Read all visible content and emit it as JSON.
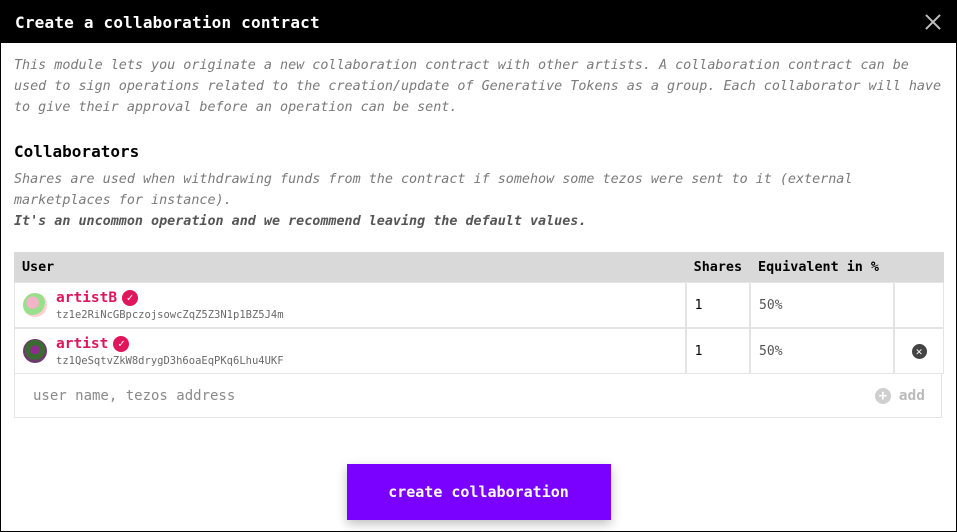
{
  "modal": {
    "title": "Create a collaboration contract",
    "intro": "This module lets you originate a new collaboration contract with other artists. A collaboration contract can be used to sign operations related to the creation/update of Generative Tokens as a group. Each collaborator will have to give their approval before an operation can be sent."
  },
  "collaborators": {
    "heading": "Collaborators",
    "description": "Shares are used when withdrawing funds from the contract if somehow some tezos were sent to it (external marketplaces for instance).",
    "note": "It's an uncommon operation and we recommend leaving the default values.",
    "table": {
      "headers": [
        "User",
        "Shares",
        "Equivalent in %"
      ],
      "rows": [
        {
          "name": "artistB",
          "address": "tz1e2RiNcGBpczojsowcZqZ5Z3N1p1BZ5J4m",
          "shares": "1",
          "percent": "50%"
        },
        {
          "name": "artist",
          "address": "tz1QeSqtvZkW8drygD3h6oaEqPKq6Lhu4UKF",
          "shares": "1",
          "percent": "50%"
        }
      ]
    },
    "add_placeholder": "user name, tezos address",
    "add_label": "add"
  },
  "actions": {
    "create_label": "create collaboration"
  },
  "colors": {
    "accent": "#7a00ff",
    "username": "#e0155c",
    "header_bg": "#000000"
  },
  "icons": [
    "close-icon",
    "verified-icon",
    "remove-icon",
    "plus-circle-icon"
  ]
}
